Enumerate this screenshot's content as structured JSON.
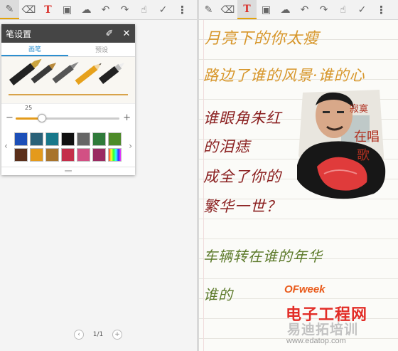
{
  "toolbar_icons": [
    "pen-icon",
    "eraser-icon",
    "text-icon",
    "camera-icon",
    "selection-icon",
    "undo-icon",
    "redo-icon",
    "hand-icon",
    "done-icon",
    "more-icon"
  ],
  "pen_settings": {
    "title": "笔设置",
    "tabs": [
      "画笔",
      "预设"
    ],
    "size_value": "25",
    "size_fraction": 0.25,
    "colors": [
      "#1c4fb8",
      "#2a6178",
      "#18788a",
      "#111111",
      "#666666",
      "#2f7a3a",
      "#4d8a28",
      "#5a2f1a",
      "#e49a1c",
      "#a8742c",
      "#c42e4a",
      "#d25084",
      "#9a2b62"
    ]
  },
  "pager": {
    "label": "1/1",
    "prev": "‹",
    "next": "+"
  },
  "note": {
    "line1": "月亮下的你太瘦",
    "line2": "路边了谁的风景·谁的心",
    "line3": "谁眼角朱红",
    "line4": "的泪痣",
    "line5": "成全了你的",
    "line6": "繁华一世？",
    "line7": "车辆转在谁的年华",
    "line8": "谁的",
    "sticker1": "寂寞",
    "sticker2": "在唱",
    "sticker3": "歌"
  },
  "watermark": {
    "logo_latin": "OFweek",
    "logo_cn": "电子工程网",
    "site_cn": "易迪拓培训",
    "url": "www.edatop.com"
  },
  "ink_colors": {
    "orange": "#d7962a",
    "red": "#8b2020",
    "green": "#5c7a2a"
  }
}
